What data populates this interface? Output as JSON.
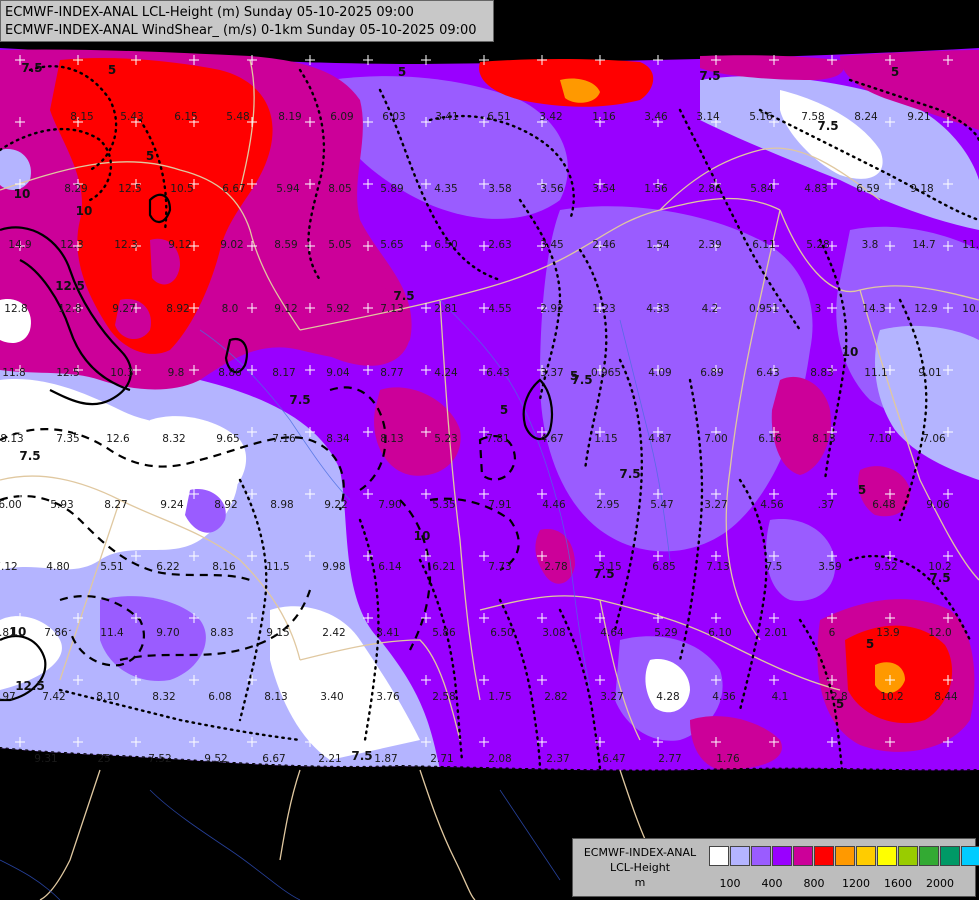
{
  "header": {
    "line1": "ECMWF-INDEX-ANAL LCL-Height (m) Sunday 05-10-2025 09:00",
    "line2": "ECMWF-INDEX-ANAL WindShear_ (m/s) 0-1km Sunday 05-10-2025 09:00"
  },
  "legend": {
    "line1": "ECMWF-INDEX-ANAL",
    "line2": "LCL-Height",
    "line3": "m",
    "colors": [
      "#ffffff",
      "#b4b4ff",
      "#9a5cff",
      "#9900ff",
      "#cc0099",
      "#ff0000",
      "#ff9900",
      "#ffcc00",
      "#ffff00",
      "#99cc00",
      "#33aa33",
      "#009966",
      "#00ccff"
    ],
    "ticks": [
      "100",
      "400",
      "800",
      "1200",
      "1600",
      "2000"
    ]
  },
  "contour_labels": [
    "7.5",
    "5",
    "5",
    "10",
    "12.5",
    "10",
    "7.5",
    "7.5",
    "5",
    "7.5",
    "10",
    "7.5",
    "7.5",
    "10",
    "5",
    "5",
    "7.5",
    "5",
    "5",
    "10",
    "12.5",
    "7.5",
    "7.5",
    "7.5",
    "5",
    "5",
    "7.5"
  ],
  "values": [
    "8.15",
    "5.43",
    "6.15",
    "5.48",
    "8.19",
    "6.09",
    "6.03",
    "3.41",
    "6.51",
    "3.42",
    "1.16",
    "3.46",
    "3.14",
    "5.16",
    "7.58",
    "8.24",
    "9.21",
    "8.29",
    "12.5",
    "10.5",
    "6.67",
    "5.94",
    "8.05",
    "5.89",
    "4.35",
    "3.58",
    "3.56",
    "3.54",
    "1.56",
    "2.86",
    "5.84",
    "4.83",
    "6.59",
    "9.18",
    "14.9",
    "12.3",
    "12.3",
    "9.12",
    "9.02",
    "8.59",
    "5.05",
    "5.65",
    "6.50",
    "2.63",
    "3.45",
    "2.46",
    "1.54",
    "2.39",
    "6.11",
    "5.28",
    "3.8",
    "14.7",
    "11.6",
    "12.8",
    "12.8",
    "9.27",
    "8.92",
    "8.0",
    "9.12",
    "5.92",
    "7.13",
    "2.81",
    "4.55",
    "2.92",
    "1.23",
    "4.33",
    "4.2",
    "0.951",
    "3",
    "14.3",
    "12.9",
    "10.9",
    "11.8",
    "12.5",
    "10.3",
    "9.8",
    "8.86",
    "8.17",
    "9.04",
    "8.77",
    "4.24",
    "6.43",
    "3.37",
    "0.965",
    "4.09",
    "6.89",
    "6.43",
    "8.83",
    "11.1",
    "9.01",
    "8.13",
    "7.35",
    "12.6",
    "8.32",
    "9.65",
    "7.16",
    "8.34",
    "8.13",
    "5.23",
    "7.81",
    "4.67",
    "1.15",
    "4.87",
    "7.00",
    "6.16",
    "8.13",
    "7.10",
    "7.06",
    "6.00",
    "5.93",
    "8.27",
    "9.24",
    "8.92",
    "8.98",
    "9.22",
    "7.90",
    "5.35",
    "7.91",
    "4.46",
    "2.95",
    "5.47",
    "3.27",
    "4.56",
    ".37",
    "6.48",
    "9.06",
    "7.12",
    "4.80",
    "5.51",
    "6.22",
    "8.16",
    "11.5",
    "9.98",
    "6.14",
    "6.21",
    "7.73",
    "2.78",
    "3.15",
    "6.85",
    "7.13",
    "7.5",
    "3.59",
    "9.52",
    "10.2",
    "8.81",
    "7.86",
    "11.4",
    "9.70",
    "8.83",
    "9.15",
    "2.42",
    "3.41",
    "5.86",
    "6.50",
    "3.08",
    "4.64",
    "5.29",
    "6.10",
    "2.01",
    "6",
    "13.9",
    "12.0",
    "9.97",
    "7.42",
    "8.10",
    "8.32",
    "6.08",
    "8.13",
    "3.40",
    "3.76",
    "2.58",
    "1.75",
    "2.82",
    "3.27",
    "4.28",
    "4.36",
    "4.1",
    "12.8",
    "10.2",
    "8.44",
    "9.31",
    "25",
    "7.52",
    "9.52",
    "6.67",
    "2.21",
    "1.87",
    "2.71",
    "2.08",
    "2.37",
    "6.47",
    "2.77",
    "1.76"
  ]
}
